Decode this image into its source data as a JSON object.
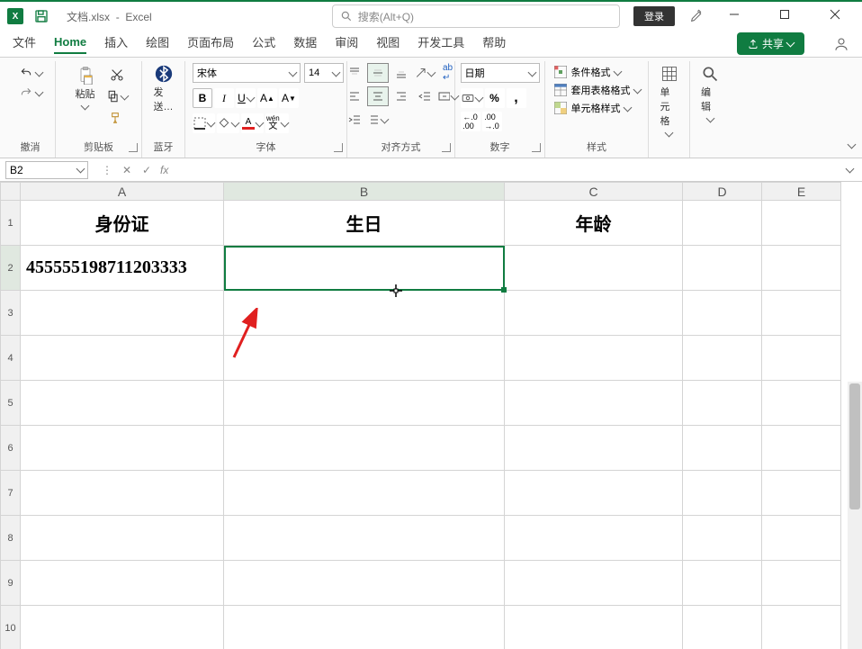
{
  "title": {
    "filename": "文档.xlsx",
    "app": "Excel",
    "sep": "-"
  },
  "search": {
    "placeholder": "搜索(Alt+Q)"
  },
  "login": {
    "label": "登录"
  },
  "tabs": {
    "file": "文件",
    "home": "Home",
    "insert": "插入",
    "draw": "绘图",
    "layout": "页面布局",
    "formulas": "公式",
    "data": "数据",
    "review": "审阅",
    "view": "视图",
    "dev": "开发工具",
    "help": "帮助"
  },
  "share": {
    "label": "共享"
  },
  "ribbon": {
    "undo_group": "撤消",
    "clipboard": {
      "label": "剪贴板",
      "paste": "粘贴"
    },
    "bluetooth": {
      "label": "蓝牙",
      "send": "发送…"
    },
    "font": {
      "label": "字体",
      "name": "宋体",
      "size": "14",
      "ruby": "wén"
    },
    "align": {
      "label": "对齐方式"
    },
    "number": {
      "label": "数字",
      "format": "日期"
    },
    "styles": {
      "label": "样式",
      "cond": "条件格式",
      "table": "套用表格格式",
      "cell": "单元格样式"
    },
    "cells": {
      "label": "单元格"
    },
    "editing": {
      "label": "编辑"
    }
  },
  "nameBox": "B2",
  "formula": "",
  "columns": [
    "A",
    "B",
    "C",
    "D",
    "E"
  ],
  "rows": [
    "1",
    "2",
    "3",
    "4",
    "5",
    "6",
    "7",
    "8",
    "9",
    "10"
  ],
  "sheet": {
    "A1": "身份证",
    "B1": "生日",
    "C1": "年龄",
    "A2": "455555198711203333"
  }
}
